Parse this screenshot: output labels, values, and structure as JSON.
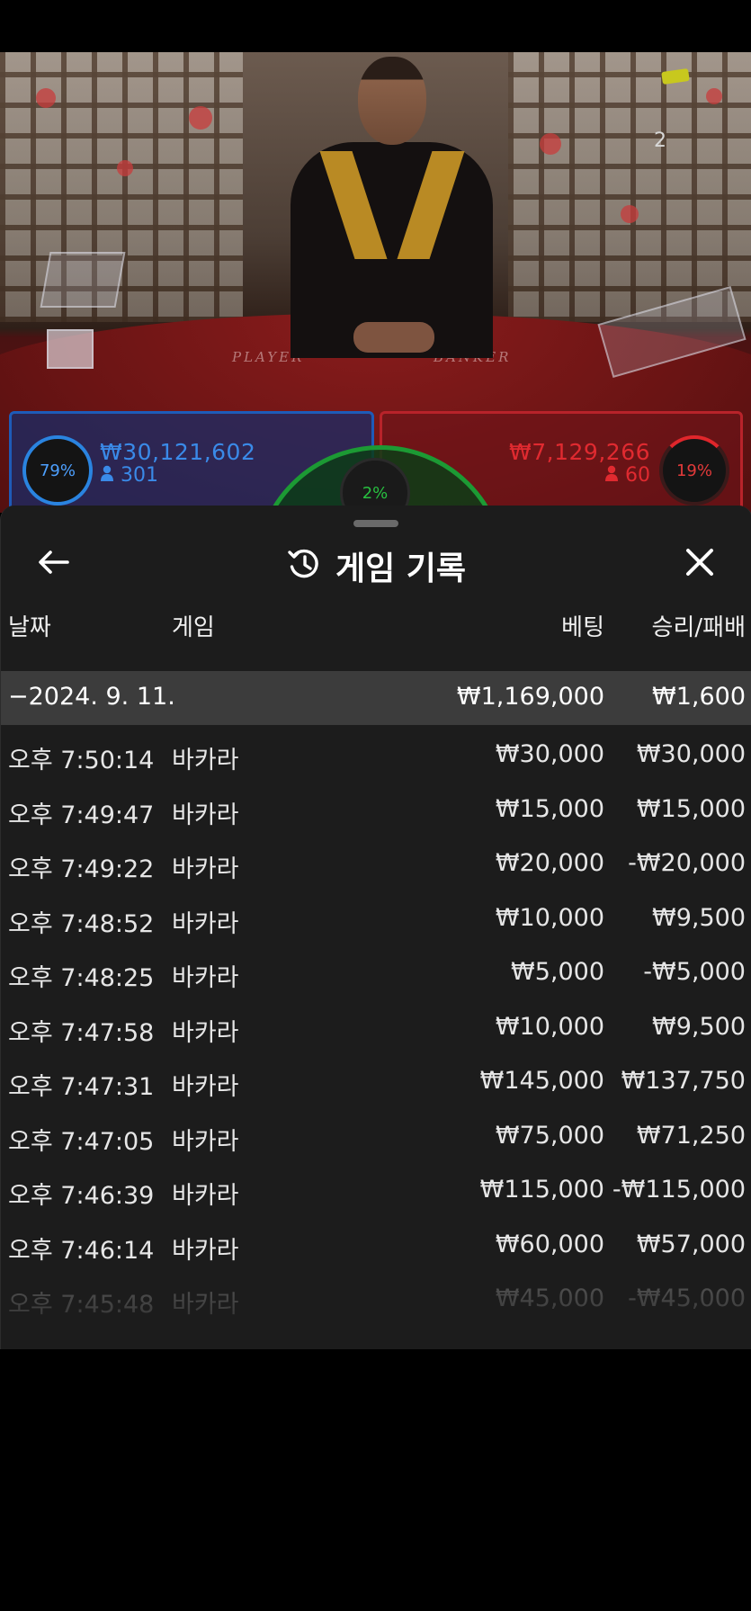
{
  "video": {
    "table_left_word": "PLAYER",
    "table_right_word": "BANKER",
    "round_count": "2",
    "player": {
      "percent": "79%",
      "amount": "₩30,121,602",
      "players": "301"
    },
    "banker": {
      "percent": "19%",
      "amount": "₩7,129,266",
      "players": "60"
    },
    "tie": {
      "percent": "2%"
    },
    "colors": {
      "player": "#2a84e0",
      "banker": "#e0262b",
      "tie": "#28c040"
    }
  },
  "sheet": {
    "title": "게임 기록",
    "icons": {
      "back": "arrow-left-icon",
      "history": "history-icon",
      "close": "close-icon",
      "user": "user-icon"
    },
    "columns": {
      "date": "날짜",
      "game": "게임",
      "bet": "베팅",
      "win_loss": "승리/패배"
    },
    "summary": {
      "date": "−2024. 9. 11.",
      "bet": "₩1,169,000",
      "win_loss": "₩1,600"
    },
    "rows": [
      {
        "time": "오후 7:50:14",
        "game": "바카라",
        "bet": "₩30,000",
        "win_loss": "₩30,000"
      },
      {
        "time": "오후 7:49:47",
        "game": "바카라",
        "bet": "₩15,000",
        "win_loss": "₩15,000"
      },
      {
        "time": "오후 7:49:22",
        "game": "바카라",
        "bet": "₩20,000",
        "win_loss": "-₩20,000"
      },
      {
        "time": "오후 7:48:52",
        "game": "바카라",
        "bet": "₩10,000",
        "win_loss": "₩9,500"
      },
      {
        "time": "오후 7:48:25",
        "game": "바카라",
        "bet": "₩5,000",
        "win_loss": "-₩5,000"
      },
      {
        "time": "오후 7:47:58",
        "game": "바카라",
        "bet": "₩10,000",
        "win_loss": "₩9,500"
      },
      {
        "time": "오후 7:47:31",
        "game": "바카라",
        "bet": "₩145,000",
        "win_loss": "₩137,750"
      },
      {
        "time": "오후 7:47:05",
        "game": "바카라",
        "bet": "₩75,000",
        "win_loss": "₩71,250"
      },
      {
        "time": "오후 7:46:39",
        "game": "바카라",
        "bet": "₩115,000",
        "win_loss": "-₩115,000"
      },
      {
        "time": "오후 7:46:14",
        "game": "바카라",
        "bet": "₩60,000",
        "win_loss": "₩57,000"
      },
      {
        "time": "오후 7:45:48",
        "game": "바카라",
        "bet": "₩45,000",
        "win_loss": "-₩45,000"
      }
    ]
  }
}
